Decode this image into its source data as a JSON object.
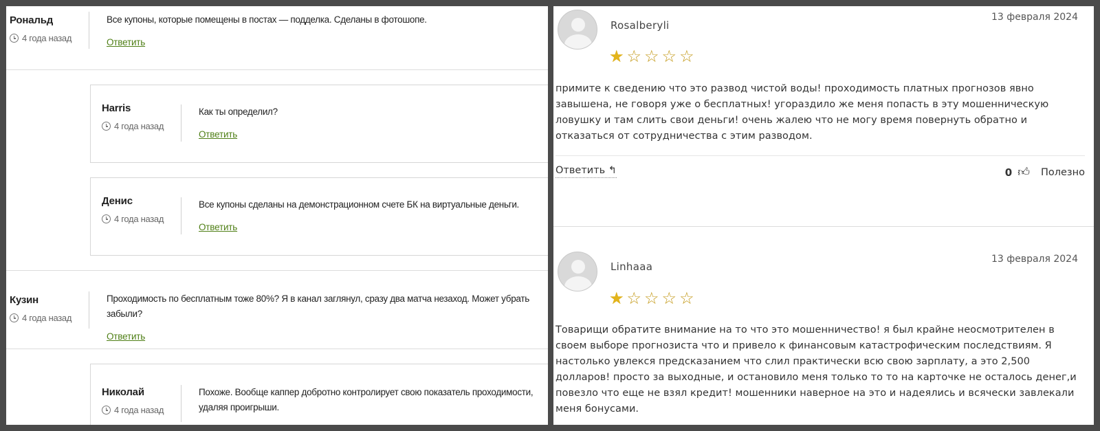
{
  "left": {
    "reply_label": "Ответить",
    "comments": [
      {
        "author": "Рональд",
        "time": "4 года назад",
        "text": "Все купоны, которые помещены в постах — подделка. Сделаны в фотошопе."
      },
      {
        "author": "Harris",
        "time": "4 года назад",
        "text": "Как ты определил?"
      },
      {
        "author": "Денис",
        "time": "4 года назад",
        "text": "Все купоны сделаны на демонстрационном счете БК на виртуальные деньги."
      },
      {
        "author": "Кузин",
        "time": "4 года назад",
        "text": "Проходимость по бесплатным тоже 80%? Я в канал заглянул, сразу два матча незаход. Может убрать забыли?"
      },
      {
        "author": "Николай",
        "time": "4 года назад",
        "text": "Похоже. Вообще каппер добротно контролирует свою показатель проходимости, удаляя проигрыши."
      }
    ]
  },
  "right": {
    "reviews": [
      {
        "author": "Rosalberyli",
        "date": "13 февраля 2024",
        "rating": 1,
        "max_rating": 5,
        "text": "примите к сведению что это развод чистой воды! проходимость платных прогнозов явно завышена, не говоря уже о бесплатных! угораздило же меня попасть в эту мошенническую ловушку и там слить свои деньги! очень жалею что не могу время повернуть обратно и отказаться от сотрудничества с этим разводом.",
        "reply_label": "Ответить ↰",
        "useful_count": "0",
        "useful_label": "Полезно"
      },
      {
        "author": "Linhaaa",
        "date": "13 февраля 2024",
        "rating": 1,
        "max_rating": 5,
        "text": "Товарищи обратите внимание на то что это мошенничество! я был крайне неосмотрителен в своем выборе прогнозиста что и привело к финансовым катастрофическим последствиям. Я настолько увлекся предсказанием что слил практически всю свою зарплату, а это 2,500 долларов! просто за выходные, и остановило меня только то то на карточке не осталось денег,и повезло что еще не взял кредит! мошенники наверное на это и надеялись и всячески завлекали меня бонусами."
      }
    ]
  }
}
